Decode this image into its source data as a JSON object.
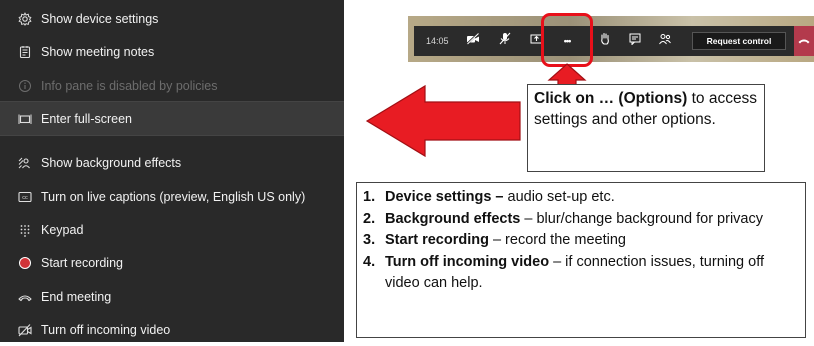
{
  "menu": {
    "items": [
      {
        "label": "Show device settings",
        "icon": "gear-icon",
        "state": "normal"
      },
      {
        "label": "Show meeting notes",
        "icon": "notes-icon",
        "state": "normal"
      },
      {
        "label": "Info pane is disabled by policies",
        "icon": "info-icon",
        "state": "disabled"
      },
      {
        "label": "Enter full-screen",
        "icon": "fullscreen-icon",
        "state": "highlighted"
      },
      {
        "label": "Show background effects",
        "icon": "background-effects-icon",
        "state": "normal"
      },
      {
        "label": "Turn on live captions (preview, English US only)",
        "icon": "captions-icon",
        "state": "normal"
      },
      {
        "label": "Keypad",
        "icon": "keypad-icon",
        "state": "normal"
      },
      {
        "label": "Start recording",
        "icon": "record-icon",
        "state": "normal"
      },
      {
        "label": "End meeting",
        "icon": "end-call-icon",
        "state": "normal"
      },
      {
        "label": "Turn off incoming video",
        "icon": "video-off-icon",
        "state": "normal"
      }
    ]
  },
  "toolbar": {
    "time": "14:05",
    "more_label": "•••",
    "request_control_label": "Request control",
    "icons": [
      "video-off-icon",
      "mic-off-icon",
      "share-icon",
      "more-options-icon",
      "raise-hand-icon",
      "chat-icon",
      "participants-icon",
      "hang-up-icon"
    ]
  },
  "callout": {
    "bold": "Click on … (Options)",
    "text": " to access settings and other options."
  },
  "list": [
    {
      "num": "1.",
      "bold": "Device settings –",
      "text": " audio set-up etc."
    },
    {
      "num": "2.",
      "bold": "Background effects",
      "text": " – blur/change background for privacy"
    },
    {
      "num": "3.",
      "bold": "Start recording",
      "text": " – record the meeting"
    },
    {
      "num": "4.",
      "bold": "Turn off incoming video",
      "text": " – if connection issues, turning off video can help."
    }
  ],
  "colors": {
    "menu_bg": "#292929",
    "accent_red": "#e8101a",
    "hangup": "#b33a4c"
  }
}
